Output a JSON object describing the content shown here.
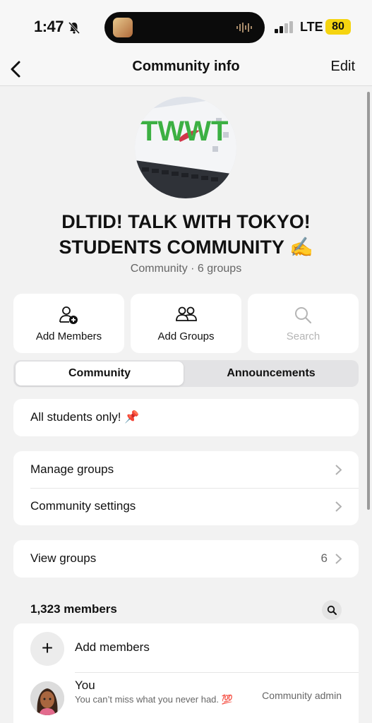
{
  "status_bar": {
    "time": "1:47",
    "network": "LTE",
    "battery": "80",
    "battery_color": "#f5d410"
  },
  "nav": {
    "title": "Community info",
    "edit_label": "Edit"
  },
  "community": {
    "name": "DLTID! TALK WITH TOKYO! STUDENTS COMMUNITY ✍️",
    "subtitle": "Community · 6 groups",
    "avatar_text": "TWWT",
    "avatar_color": "#3cb043"
  },
  "actions": [
    {
      "label": "Add Members",
      "icon": "person-add-icon",
      "enabled": true
    },
    {
      "label": "Add Groups",
      "icon": "people-icon",
      "enabled": true
    },
    {
      "label": "Search",
      "icon": "search-icon",
      "enabled": false
    }
  ],
  "tabs": [
    {
      "label": "Community",
      "selected": true
    },
    {
      "label": "Announcements",
      "selected": false
    }
  ],
  "description": "All students only! 📌",
  "settings": [
    {
      "label": "Manage groups"
    },
    {
      "label": "Community settings"
    }
  ],
  "view_groups": {
    "label": "View groups",
    "count": "6"
  },
  "members": {
    "count_label": "1,323 members",
    "add_label": "Add members",
    "list": [
      {
        "name": "You",
        "status": "You can’t miss what you never had. 💯",
        "role": "Community admin"
      }
    ]
  }
}
